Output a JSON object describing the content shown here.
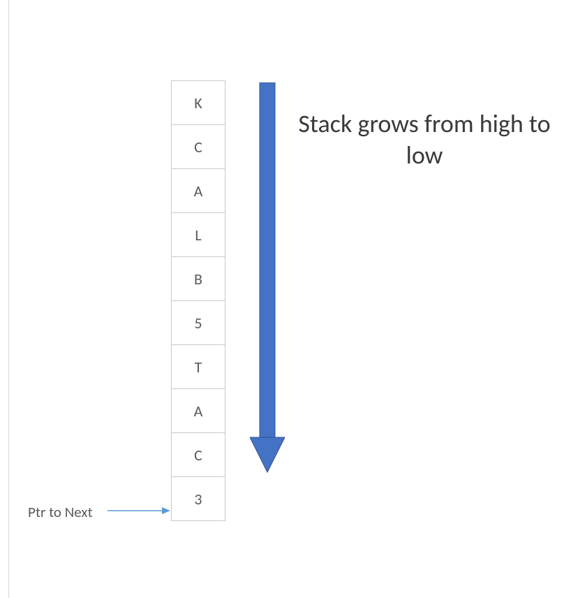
{
  "stack": {
    "cells": [
      "K",
      "C",
      "A",
      "L",
      "B",
      "5",
      "T",
      "A",
      "C",
      "3"
    ]
  },
  "title": "Stack grows from high to low",
  "pointer_label": "Ptr to Next",
  "colors": {
    "arrow": "#4472C4",
    "ptr_arrow": "#5B9BD5",
    "grid": "#c9c9c9",
    "text": "#595959"
  }
}
